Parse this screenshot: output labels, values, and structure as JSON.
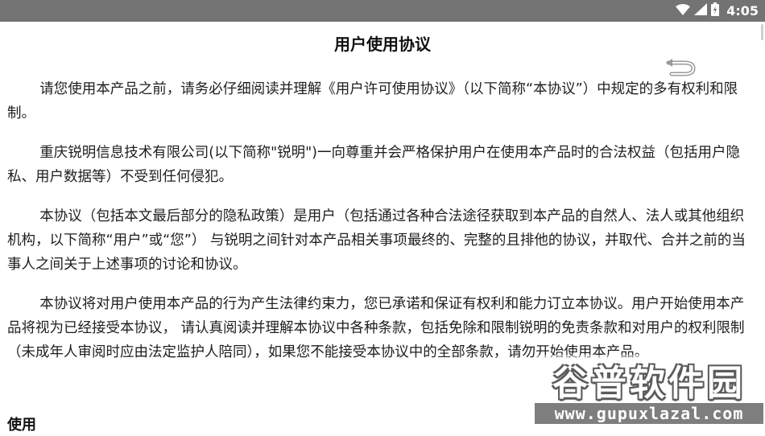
{
  "status_bar": {
    "time": "4:05",
    "background": "#737373",
    "icons": [
      "wifi-icon",
      "cellular-signal-icon",
      "battery-icon"
    ]
  },
  "document": {
    "title": "用户使用协议",
    "back_icon": "back-arrow-icon",
    "paragraphs": [
      "请您使用本产品之前，请务必仔细阅读并理解《用户许可使用协议》（以下简称“本协议”）中规定的多有权利和限制。",
      "重庆锐明信息技术有限公司(以下简称\"锐明\")一向尊重并会严格保护用户在使用本产品时的合法权益（包括用户隐私、用户数据等）不受到任何侵犯。",
      "本协议（包括本文最后部分的隐私政策）是用户（包括通过各种合法途径获取到本产品的自然人、法人或其他组织机构，以下简称“用户”或“您”） 与锐明之间针对本产品相关事项最终的、完整的且排他的协议，并取代、合并之前的当事人之间关于上述事项的讨论和协议。",
      "本协议将对用户使用本产品的行为产生法律约束力，您已承诺和保证有权利和能力订立本协议。用户开始使用本产品将视为已经接受本协议， 请认真阅读并理解本协议中各种条款，包括免除和限制锐明的免责条款和对用户的权利限制（未成年人审阅时应由法定监护人陪同），如果您不能接受本协议中的全部条款，请勿开始使用本产品。"
    ],
    "section_heading": "使用"
  },
  "watermark": {
    "title": "谷普软件园",
    "url": "www.gupuxlazal.com"
  }
}
